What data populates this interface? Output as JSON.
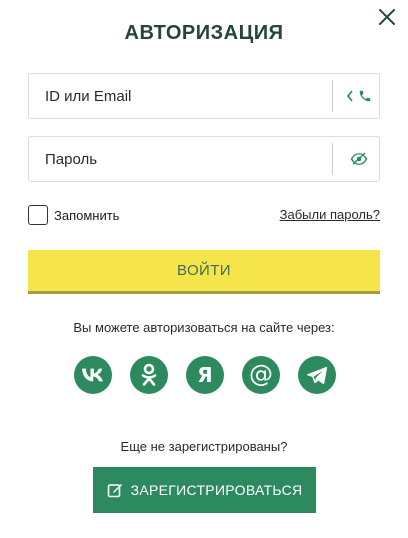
{
  "dialog": {
    "title": "АВТОРИЗАЦИЯ",
    "close_icon": "close-icon"
  },
  "form": {
    "login_placeholder": "ID или Email",
    "login_toggle_icons": [
      "chevron-left-icon",
      "phone-icon"
    ],
    "password_placeholder": "Пароль",
    "password_toggle_icon": "eye-off-icon",
    "remember_label": "Запомнить",
    "remember_checked": false,
    "forgot_label": "Забыли пароль?",
    "submit_label": "ВОЙТИ"
  },
  "social": {
    "caption": "Вы можете авторизоваться на сайте через:",
    "providers": [
      "vk-icon",
      "odnoklassniki-icon",
      "yandex-icon",
      "mail-ru-icon",
      "telegram-icon"
    ],
    "yandex_glyph": "Я",
    "mail_glyph": "@"
  },
  "register": {
    "caption": "Еще не зарегистрированы?",
    "button_label": "ЗАРЕГИСТРИРОВАТЬСЯ",
    "button_icon": "edit-icon"
  },
  "colors": {
    "accent_green": "#2d8a5f",
    "title_green": "#24453a",
    "button_yellow": "#f5e44a",
    "button_text": "#3d6f52"
  }
}
